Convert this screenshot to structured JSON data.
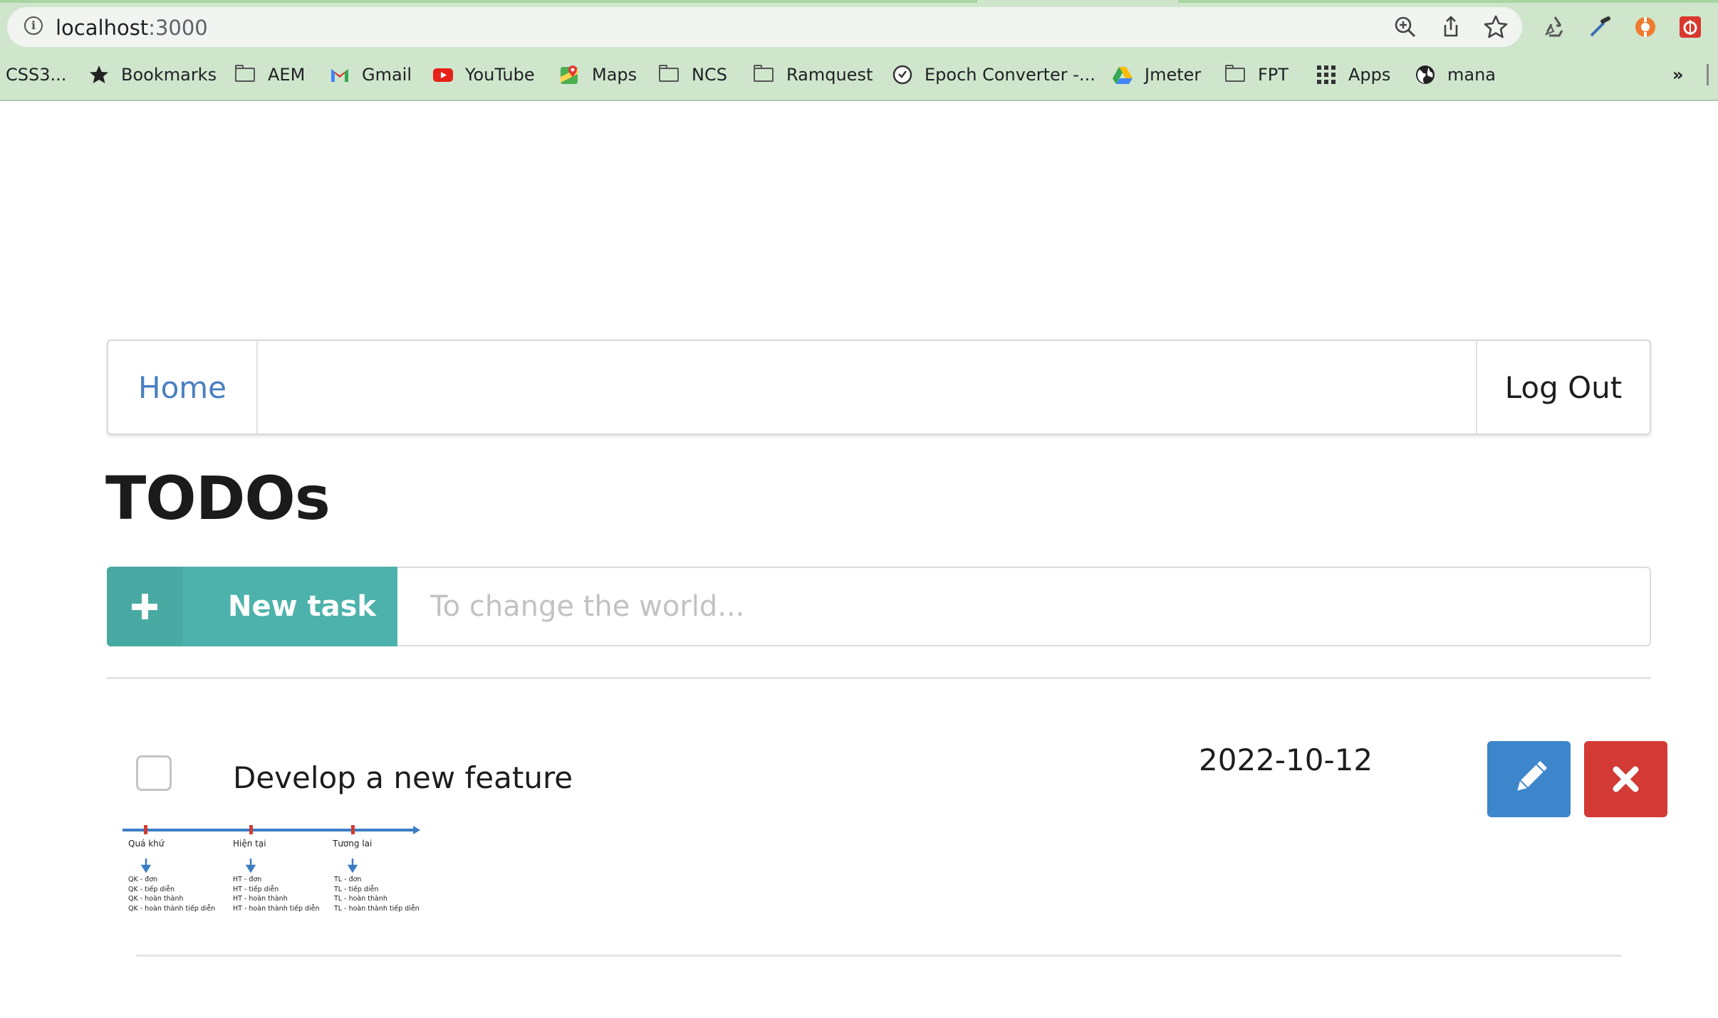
{
  "browser": {
    "url_host": "localhost",
    "url_port": ":3000",
    "bookmarks": [
      {
        "label": "CSS3...",
        "icon": "none"
      },
      {
        "label": "Bookmarks",
        "icon": "star-icon"
      },
      {
        "label": "AEM",
        "icon": "folder-icon"
      },
      {
        "label": "Gmail",
        "icon": "gmail-icon"
      },
      {
        "label": "YouTube",
        "icon": "youtube-icon"
      },
      {
        "label": "Maps",
        "icon": "maps-icon"
      },
      {
        "label": "NCS",
        "icon": "folder-icon"
      },
      {
        "label": "Ramquest",
        "icon": "folder-icon"
      },
      {
        "label": "Epoch Converter -...",
        "icon": "clock-icon"
      },
      {
        "label": "Jmeter",
        "icon": "drive-icon"
      },
      {
        "label": "FPT",
        "icon": "folder-icon"
      },
      {
        "label": "Apps",
        "icon": "apps-grid-icon"
      },
      {
        "label": "mana",
        "icon": "globe-icon"
      }
    ],
    "overflow_label": "»"
  },
  "nav": {
    "home_label": "Home",
    "logout_label": "Log Out"
  },
  "page": {
    "title": "TODOs"
  },
  "new_task": {
    "button_label": "New task",
    "input_placeholder": "To change the world...",
    "input_value": ""
  },
  "todos": [
    {
      "title": "Develop a new feature",
      "date": "2022-10-12",
      "done": false,
      "image": {
        "timeline_labels": [
          "Quá khứ",
          "Hiện tại",
          "Tương lai"
        ],
        "columns": [
          [
            "QK - đơn",
            "QK - tiếp diễn",
            "QK - hoàn thành",
            "QK - hoàn thành tiếp diễn"
          ],
          [
            "HT - đơn",
            "HT - tiếp diễn",
            "HT - hoàn thành",
            "HT - hoàn thành tiếp diễn"
          ],
          [
            "TL - đơn",
            "TL - tiếp diễn",
            "TL - hoàn thành",
            "TL - hoàn thành tiếp diễn"
          ]
        ]
      }
    }
  ],
  "colors": {
    "accent_teal": "#4db2ab",
    "edit_blue": "#3d86cc",
    "delete_red": "#d33a35",
    "link_blue": "#4a7fc1",
    "chrome_green": "#cfe6cd"
  }
}
